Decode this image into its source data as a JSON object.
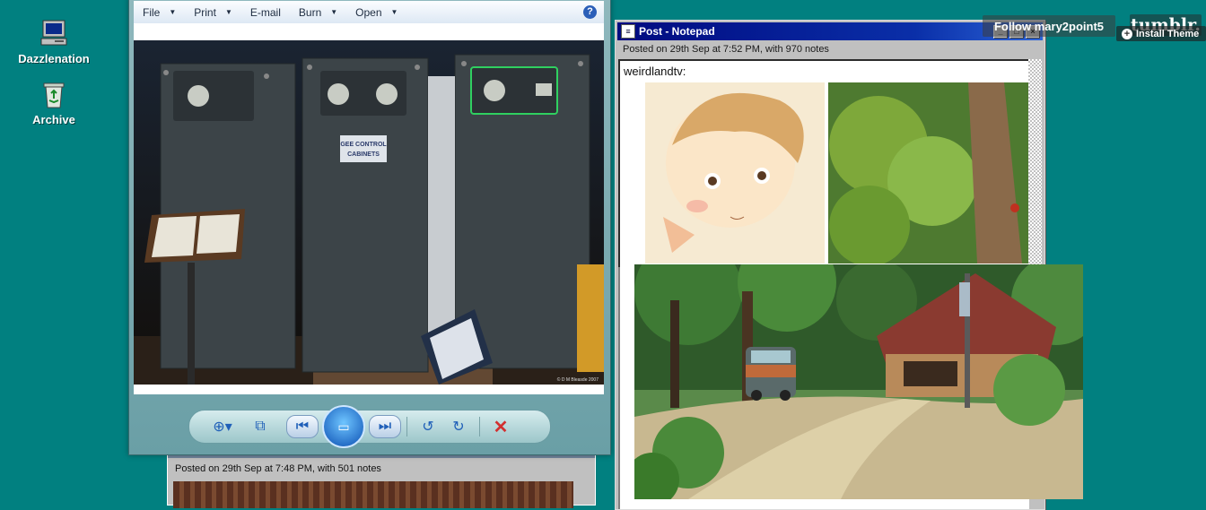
{
  "desktop": {
    "icons": [
      {
        "label": "Dazzlenation",
        "icon": "computer-icon"
      },
      {
        "label": "Archive",
        "icon": "recycle-bin-icon"
      }
    ]
  },
  "viewer": {
    "menu": [
      {
        "label": "File",
        "has_caret": true
      },
      {
        "label": "Print",
        "has_caret": true
      },
      {
        "label": "E-mail",
        "has_caret": false
      },
      {
        "label": "Burn",
        "has_caret": true
      },
      {
        "label": "Open",
        "has_caret": true
      }
    ],
    "help_glyph": "?",
    "photo": {
      "sign_text": "GEE CONTROL CABINETS",
      "copyright": "© D M Bleasde 2007"
    },
    "controls": [
      "zoom-icon",
      "fit-window-icon",
      "previous-icon",
      "slideshow-icon",
      "next-icon",
      "rotate-ccw-icon",
      "rotate-cw-icon",
      "delete-icon"
    ]
  },
  "notepad_lower": {
    "title": "Post - Notepad",
    "info": "Posted on 29th Sep at 7:48 PM, with 501 notes"
  },
  "notepad": {
    "title": "Post - Notepad",
    "info": "Posted on 29th Sep at 7:52 PM, with 970 notes",
    "body_text": "weirdlandtv:",
    "window_buttons": [
      "_",
      "□",
      "×"
    ]
  },
  "tumblr": {
    "follow_label": "Follow mary2point5",
    "logo": "tumblr.",
    "install_label": "Install Theme"
  },
  "colors": {
    "desktop": "#018080",
    "titlebar": "#000a80",
    "accent": "#1f5fb8"
  }
}
